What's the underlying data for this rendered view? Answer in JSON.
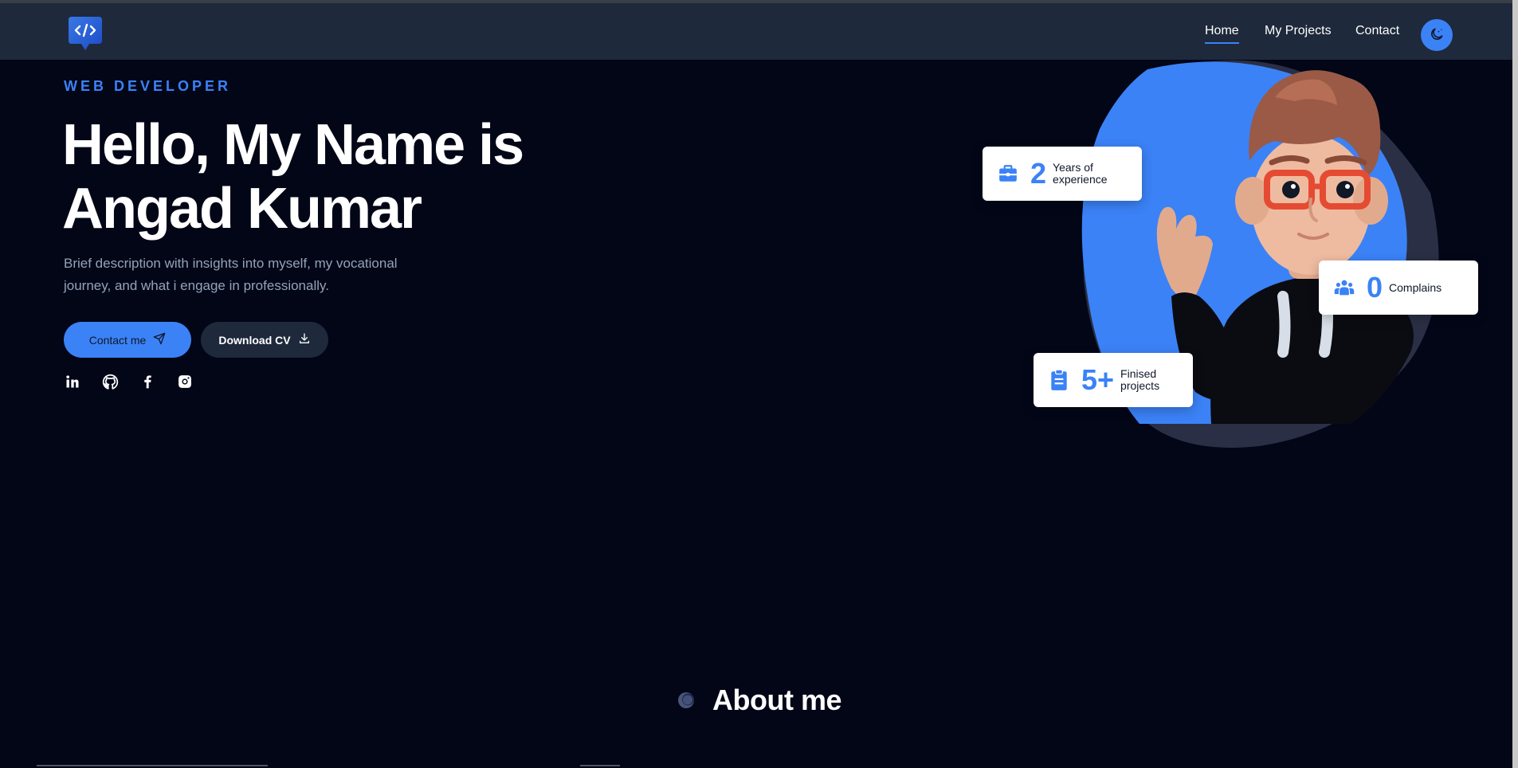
{
  "nav": {
    "logo_icon": "code-bubble-icon",
    "links": [
      {
        "label": "Home",
        "active": true
      },
      {
        "label": "My Projects",
        "active": false
      },
      {
        "label": "Contact",
        "active": false
      }
    ],
    "theme_toggle_icon": "moon-icon"
  },
  "hero": {
    "eyebrow": "WEB DEVELOPER",
    "headline_line1": "Hello, My Name is",
    "headline_line2": "Angad Kumar",
    "description": "Brief description with insights into myself, my vocational journey, and what i engage in professionally.",
    "contact_button": "Contact me",
    "contact_button_icon": "paper-plane-icon",
    "cv_button": "Download CV",
    "cv_button_icon": "download-icon",
    "socials": [
      {
        "name": "linkedin-icon"
      },
      {
        "name": "github-icon"
      },
      {
        "name": "facebook-icon"
      },
      {
        "name": "instagram-icon"
      }
    ]
  },
  "stats": [
    {
      "icon": "briefcase-icon",
      "number": "2",
      "label": "Years of experience"
    },
    {
      "icon": "users-icon",
      "number": "0",
      "label": "Complains"
    },
    {
      "icon": "clipboard-icon",
      "number": "5+",
      "label": "Finised projects"
    }
  ],
  "about": {
    "title": "About me"
  },
  "colors": {
    "accent": "#3b82f6",
    "background": "#020617",
    "navbar": "#1e293b",
    "muted_text": "#94a3b8"
  }
}
